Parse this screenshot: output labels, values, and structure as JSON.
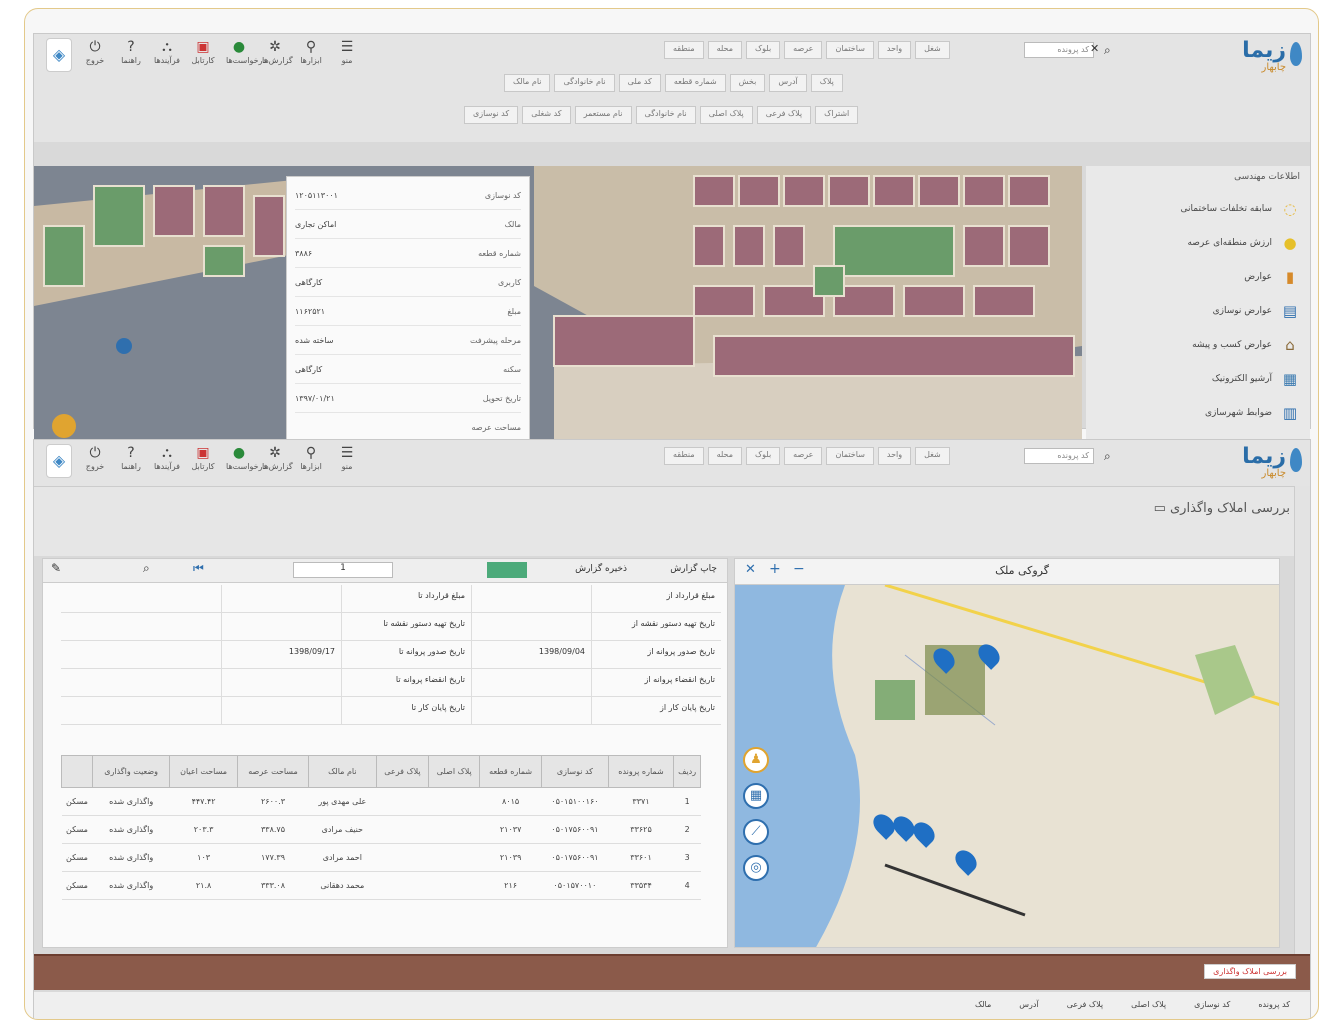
{
  "app": {
    "brand": "زیما",
    "brand_sub": "چابهار",
    "icon_bar": [
      {
        "label": "خروج",
        "icon": "power-icon"
      },
      {
        "label": "راهنما",
        "icon": "help-icon"
      },
      {
        "label": "فرآیندها",
        "icon": "org-chart-icon"
      },
      {
        "label": "کارتابل",
        "icon": "inbox-icon",
        "badge": ""
      },
      {
        "label": "درخواست‌ها",
        "icon": "chat-icon",
        "badge": ""
      },
      {
        "label": "گزارش‌ها",
        "icon": "gear-icon"
      },
      {
        "label": "ابزارها",
        "icon": "pin-icon"
      },
      {
        "label": "منو",
        "icon": "menu-icon"
      }
    ],
    "search_placeholder": "کد پرونده",
    "search_hint": "جستجو"
  },
  "top": {
    "chips_row1": [
      "منطقه",
      "محله",
      "بلوک",
      "عرصه",
      "ساختمان",
      "واحد",
      "شغل"
    ],
    "chips_row2": [
      "نام مالک",
      "نام خانوادگی",
      "کد ملی",
      "شماره قطعه",
      "بخش",
      "آدرس",
      "پلاک"
    ],
    "chips_row3": [
      "کد نوسازی",
      "کد شغلی",
      "نام مستعمر",
      "نام خانوادگی",
      "پلاک اصلی",
      "پلاک فرعی",
      "اشتراک"
    ]
  },
  "sidebar": {
    "header": "اطلاعات مهندسی",
    "items": [
      {
        "label": "سابقه تخلفات ساختمانی",
        "icon": "history-icon"
      },
      {
        "label": "ارزش منطقه‌ای عرصه",
        "icon": "coin-icon"
      },
      {
        "label": "عوارض",
        "icon": "chart-icon"
      },
      {
        "label": "عوارض نوسازی",
        "icon": "document-icon"
      },
      {
        "label": "عوارض کسب و پیشه",
        "icon": "shop-icon"
      },
      {
        "label": "آرشیو الکترونیک",
        "icon": "archive-icon"
      },
      {
        "label": "ضوابط شهرسازی",
        "icon": "book-icon"
      }
    ]
  },
  "popup": {
    "rows": [
      {
        "k": "کد نوسازی",
        "v": "۱۲۰۵۱۱۳۰۰۱"
      },
      {
        "k": "مالک",
        "v": "اماکن تجاری"
      },
      {
        "k": "شماره قطعه",
        "v": "۳۸۸۶"
      },
      {
        "k": "کاربری",
        "v": "کارگاهی"
      },
      {
        "k": "مبلغ",
        "v": "۱۱۶۲۵۲۱"
      },
      {
        "k": "مرحله پیشرفت",
        "v": "ساخته شده"
      },
      {
        "k": "سکنه",
        "v": "کارگاهی"
      },
      {
        "k": "تاریخ تحویل",
        "v": "۱۳۹۷/۰۱/۲۱"
      },
      {
        "k": "مساحت عرصه",
        "v": ""
      }
    ]
  },
  "page2": {
    "title": "بررسی املاک واگذاری",
    "grid_toolbar": {
      "print": "چاپ گزارش",
      "save": "ذخیره گزارش",
      "page": "1"
    },
    "filters": [
      [
        "مبلغ قرارداد از",
        "",
        "مبلغ قرارداد تا",
        ""
      ],
      [
        "تاریخ تهیه دستور نقشه از",
        "",
        "تاریخ تهیه دستور نقشه تا",
        ""
      ],
      [
        "تاریخ صدور پروانه از",
        "1398/09/04",
        "تاریخ صدور پروانه تا",
        "1398/09/17"
      ],
      [
        "تاریخ انقضاء پروانه از",
        "",
        "تاریخ انقضاء پروانه تا",
        ""
      ],
      [
        "تاریخ پایان کار از",
        "",
        "تاریخ پایان کار تا",
        ""
      ]
    ],
    "table": {
      "headers": [
        "ردیف",
        "شماره پرونده",
        "کد نوسازی",
        "شماره قطعه",
        "پلاک اصلی",
        "پلاک فرعی",
        "نام مالک",
        "مساحت عرصه",
        "مساحت اعیان",
        "وضعیت واگذاری",
        ""
      ],
      "rows": [
        [
          "1",
          "۳۳۷۱",
          "۰۵۰۱۵۱۰۰۱۶۰",
          "۸۰۱۵",
          "",
          "",
          "علی مهدی پور",
          "۲۶۰۰.۳",
          "۴۴۷.۴۲",
          "واگذاری شده",
          "مسکن"
        ],
        [
          "2",
          "۳۳۶۲۵",
          "۰۵۰۱۷۵۶۰۰۹۱",
          "۲۱۰۳۷",
          "",
          "",
          "حنیف مرادی",
          "۳۳۸.۷۵",
          "۲۰۳.۳",
          "واگذاری شده",
          "مسکن"
        ],
        [
          "3",
          "۳۳۶۰۱",
          "۰۵۰۱۷۵۶۰۰۹۱",
          "۲۱۰۳۹",
          "",
          "",
          "احمد مرادی",
          "۱۷۷.۳۹",
          "۱۰۳",
          "واگذاری شده",
          "مسکن"
        ],
        [
          "4",
          "۳۳۵۳۴",
          "۰۵۰۱۵۷۰۰۱۰",
          "۲۱۶",
          "",
          "",
          "محمد دهقانی",
          "۳۳۳.۰۸",
          "۲۱.۸",
          "واگذاری شده",
          "مسکن"
        ]
      ]
    },
    "map_title": "گروکی ملک",
    "bottom_tab": "بررسی املاک واگذاری",
    "footer_cols": [
      "کد پرونده",
      "کد نوسازی",
      "پلاک اصلی",
      "پلاک فرعی",
      "آدرس",
      "مالک"
    ]
  }
}
